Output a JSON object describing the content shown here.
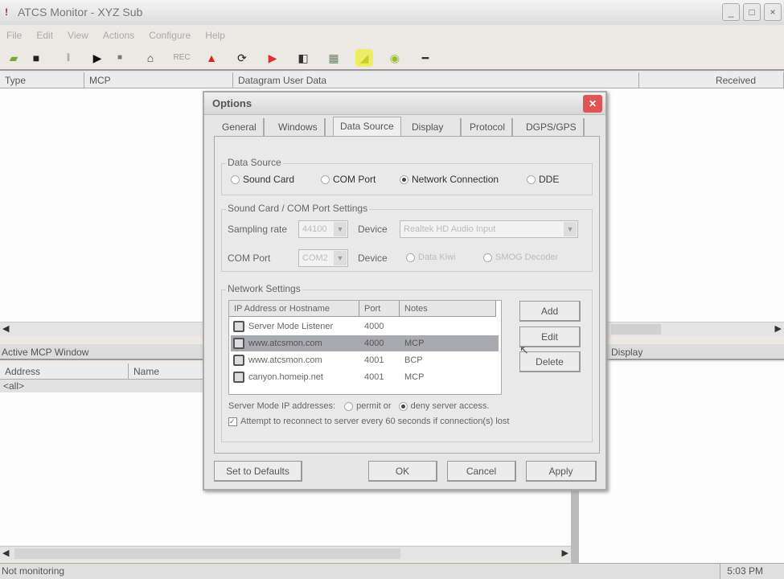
{
  "app": {
    "title": "ATCS Monitor - XYZ Sub"
  },
  "menu": [
    "File",
    "Edit",
    "View",
    "Actions",
    "Configure",
    "Help"
  ],
  "toolbar": {
    "rec_label": "REC"
  },
  "main_columns": [
    "Type",
    "MCP",
    "Datagram User Data",
    "Received"
  ],
  "mcp_panel": {
    "title": "Active MCP Window",
    "columns": [
      "Address",
      "Name"
    ],
    "rows": [
      "<all>"
    ]
  },
  "right_panel": {
    "title": "Display"
  },
  "status": {
    "text": "Not monitoring",
    "time": "5:03 PM"
  },
  "dialog": {
    "title": "Options",
    "tabs": [
      "General",
      "Windows",
      "Data Source",
      "Display",
      "Protocol",
      "DGPS/GPS"
    ],
    "active_tab": "Data Source",
    "data_source": {
      "label": "Data Source",
      "options": [
        "Sound Card",
        "COM Port",
        "Network Connection",
        "DDE"
      ],
      "selected": "Network Connection"
    },
    "soundcard": {
      "label": "Sound Card / COM Port Settings",
      "sampling_label": "Sampling rate",
      "sampling_value": "44100",
      "device_label": "Device",
      "device_value": "Realtek HD Audio Input",
      "com_label": "COM Port",
      "com_value": "COM2",
      "com_device_label": "Device",
      "com_device_options": [
        "Data Kiwi",
        "SMOG Decoder"
      ]
    },
    "network": {
      "label": "Network Settings",
      "columns": [
        "IP Address or Hostname",
        "Port",
        "Notes"
      ],
      "rows": [
        {
          "host": "Server Mode Listener",
          "port": "4000",
          "notes": ""
        },
        {
          "host": "www.atcsmon.com",
          "port": "4000",
          "notes": "MCP"
        },
        {
          "host": "www.atcsmon.com",
          "port": "4001",
          "notes": "BCP"
        },
        {
          "host": "canyon.homeip.net",
          "port": "4001",
          "notes": "MCP"
        }
      ],
      "selected_row": 1,
      "add": "Add",
      "edit": "Edit",
      "delete": "Delete",
      "server_mode_label": "Server Mode IP addresses:",
      "permit_label": "permit or",
      "deny_label": "deny server access.",
      "reconnect_label": "Attempt to reconnect to server every 60 seconds if connection(s) lost",
      "reconnect_checked": true
    },
    "buttons": {
      "defaults": "Set to Defaults",
      "ok": "OK",
      "cancel": "Cancel",
      "apply": "Apply"
    }
  }
}
